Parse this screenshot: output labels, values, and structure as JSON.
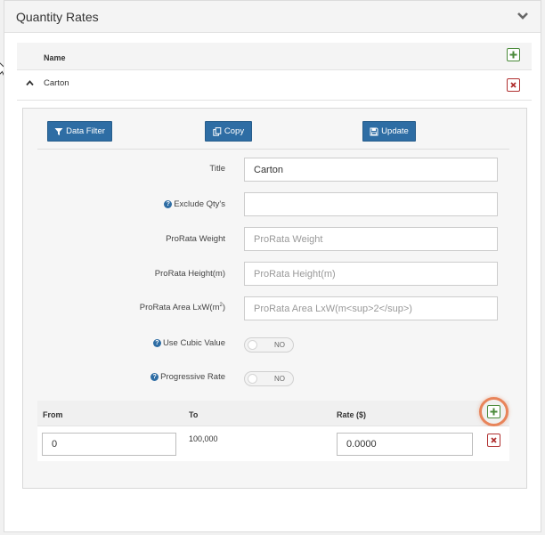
{
  "panel": {
    "title": "Quantity Rates"
  },
  "grid": {
    "column_name": "Name",
    "rows": [
      {
        "name": "Carton"
      }
    ]
  },
  "toolbar": {
    "data_filter_label": "Data Filter",
    "copy_label": "Copy",
    "update_label": "Update"
  },
  "form": {
    "title": {
      "label": "Title",
      "value": "Carton",
      "placeholder": ""
    },
    "exclude_qtys": {
      "label": "Exclude Qty's",
      "value": "",
      "placeholder": ""
    },
    "prorata_weight": {
      "label": "ProRata Weight",
      "value": "",
      "placeholder": "ProRata Weight"
    },
    "prorata_height": {
      "label": "ProRata Height(m)",
      "value": "",
      "placeholder": "ProRata Height(m)"
    },
    "prorata_area": {
      "label": "ProRata Area LxW(m",
      "label_sup": "2",
      "label_close": ")",
      "value": "",
      "placeholder": "ProRata Area LxW(m<sup>2</sup>)"
    },
    "use_cubic_value": {
      "label": "Use Cubic Value",
      "state": "NO"
    },
    "progressive_rate": {
      "label": "Progressive Rate",
      "state": "NO"
    }
  },
  "rates": {
    "columns": {
      "from": "From",
      "to": "To",
      "rate": "Rate ($)"
    },
    "rows": [
      {
        "from": "0",
        "to": "100,000",
        "rate": "0.0000"
      }
    ]
  },
  "colors": {
    "primary_button": "#2e6da4",
    "add_icon": "#4a8a3a",
    "delete_icon": "#b03030",
    "highlight": "#e8845a"
  },
  "icons": {
    "collapse": "chevron-down-icon",
    "expand": "caret-up-icon",
    "add": "plus-square-icon",
    "delete": "x-square-icon",
    "filter": "funnel-icon",
    "copy": "copy-icon",
    "update": "save-icon",
    "help": "question-circle-icon"
  }
}
